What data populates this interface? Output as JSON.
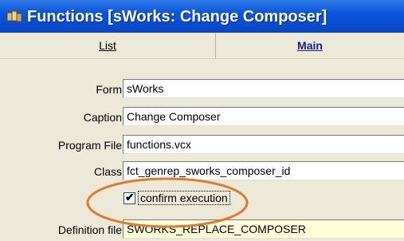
{
  "window": {
    "title": "Functions  [sWorks: Change Composer]"
  },
  "tabs": [
    {
      "label": "List"
    },
    {
      "label": "Main"
    }
  ],
  "fields": {
    "form": {
      "label": "Form",
      "value": "sWorks"
    },
    "caption": {
      "label": "Caption",
      "value": "Change Composer"
    },
    "program_file": {
      "label": "Program File",
      "value": "functions.vcx"
    },
    "class": {
      "label": "Class",
      "value": "fct_genrep_sworks_composer_id"
    },
    "definition_file": {
      "label": "Definition file",
      "value": "SWORKS_REPLACE_COMPOSER"
    }
  },
  "confirm_execution": {
    "label": "confirm execution",
    "checked": true
  },
  "colors": {
    "titlebar": "#0a55d8",
    "highlight_ellipse": "#e07a30",
    "definition_bg": "#ffffd9"
  }
}
